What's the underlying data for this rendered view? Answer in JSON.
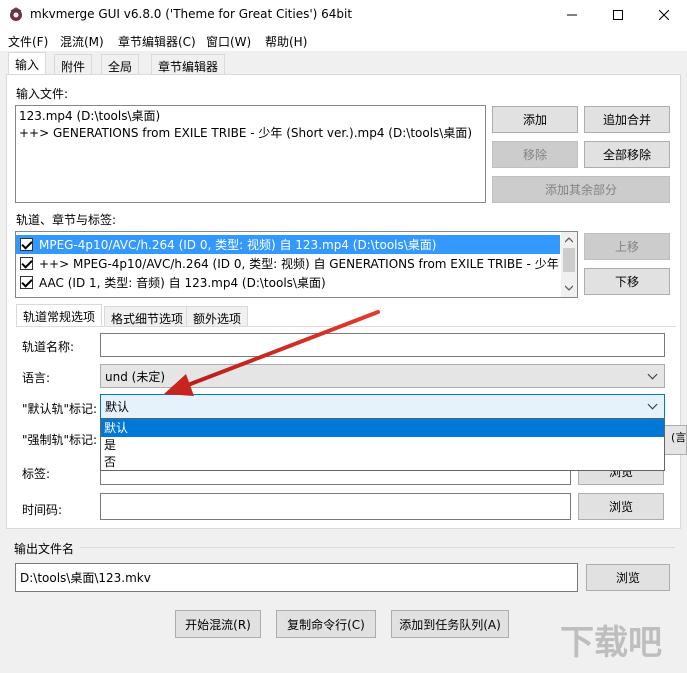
{
  "window": {
    "title": "mkvmerge GUI v6.8.0 ('Theme for Great Cities') 64bit",
    "minimize": "–",
    "maximize": "☐",
    "close": "✕"
  },
  "menu": [
    "文件(F)",
    "混流(M)",
    "章节编辑器(C)",
    "窗口(W)",
    "帮助(H)"
  ],
  "main_tabs": [
    "输入",
    "附件",
    "全局",
    "章节编辑器"
  ],
  "input_files": {
    "label": "输入文件:",
    "items": [
      "123.mp4 (D:\\tools\\桌面)",
      "++> GENERATIONS from EXILE TRIBE - 少年 (Short ver.).mp4 (D:\\tools\\桌面)"
    ],
    "buttons": {
      "add": "添加",
      "append": "追加合并",
      "remove": "移除",
      "remove_all": "全部移除",
      "add_rest": "添加其余部分"
    }
  },
  "tracks": {
    "label": "轨道、章节与标签:",
    "items": [
      "MPEG-4p10/AVC/h.264 (ID 0, 类型: 视频) 自 123.mp4 (D:\\tools\\桌面)",
      "++> MPEG-4p10/AVC/h.264 (ID 0, 类型: 视频) 自 GENERATIONS from EXILE TRIBE - 少年 (",
      "AAC (ID 1, 类型: 音频) 自 123.mp4 (D:\\tools\\桌面)"
    ],
    "buttons": {
      "up": "上移",
      "down": "下移"
    }
  },
  "sub_tabs": [
    "轨道常规选项",
    "格式细节选项",
    "额外选项"
  ],
  "track_options": {
    "name_label": "轨道名称:",
    "name_value": "",
    "language_label": "语言:",
    "language_value": "und (未定)",
    "default_label": "\"默认轨\"标记:",
    "default_value": "默认",
    "default_options": [
      "默认",
      "是",
      "否"
    ],
    "forced_label": "\"强制轨\"标记:",
    "forced_partial": "(言",
    "tags_label": "标签:",
    "tags_browse": "浏览",
    "timecode_label": "时间码:",
    "timecode_browse": "浏览"
  },
  "output": {
    "label": "输出文件名",
    "value": "D:\\tools\\桌面\\123.mkv",
    "browse": "浏览"
  },
  "bottom_buttons": {
    "start": "开始混流(R)",
    "copy": "复制命令行(C)",
    "queue": "添加到任务队列(A)"
  },
  "watermark": "下载吧",
  "colors": {
    "accent": "#0078d7",
    "selection": "#3399ff",
    "arrow": "#d42a22"
  }
}
